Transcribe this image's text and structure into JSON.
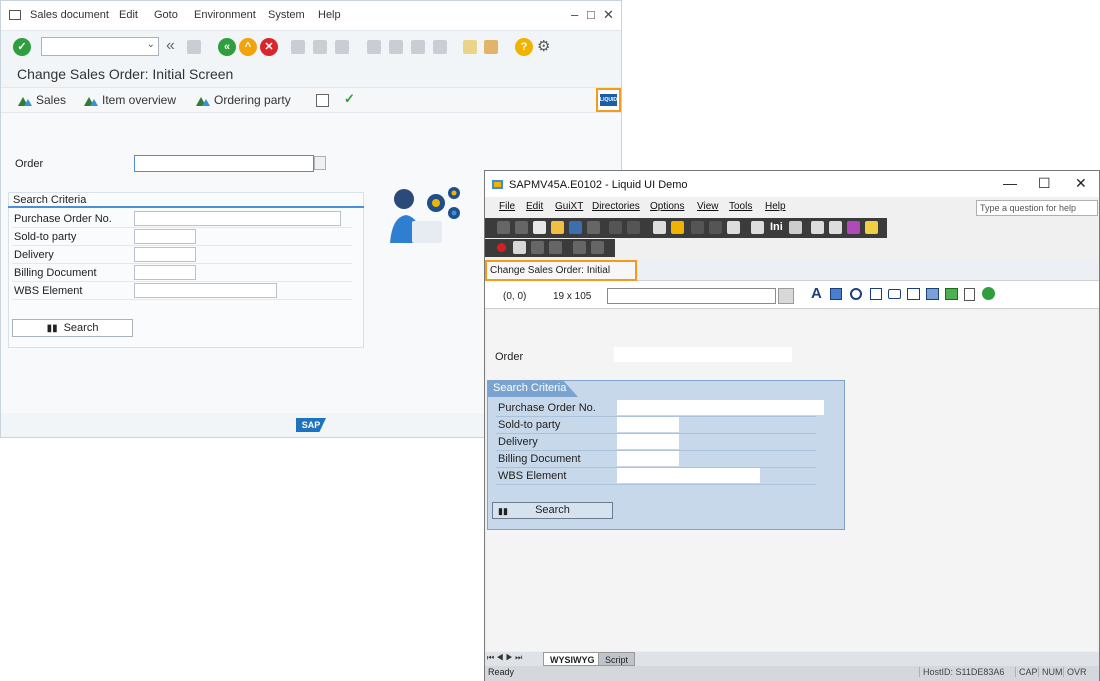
{
  "sap": {
    "menu": [
      "Sales document",
      "Edit",
      "Goto",
      "Environment",
      "System",
      "Help"
    ],
    "screen_title": "Change Sales Order: Initial Screen",
    "app_toolbar": [
      "Sales",
      "Item overview",
      "Ordering party"
    ],
    "order_label": "Order",
    "search_criteria": {
      "title": "Search Criteria",
      "fields": [
        "Purchase Order No.",
        "Sold-to party",
        "Delivery",
        "Billing Document",
        "WBS Element"
      ],
      "button": "Search"
    },
    "logo": "SAP",
    "liquid_button_text": "LIQUID"
  },
  "liquid_ui": {
    "window_title": "SAPMV45A.E0102 - Liquid UI Demo",
    "menu": [
      "File",
      "Edit",
      "GuiXT",
      "Directories",
      "Options",
      "View",
      "Tools",
      "Help"
    ],
    "help_placeholder": "Type a question for help",
    "screen_tab": "Change Sales Order: Initial Screen",
    "coord": "(0, 0)",
    "size": "19 x 105",
    "order_label": "Order",
    "search_criteria": {
      "title": "Search Criteria",
      "fields": [
        "Purchase Order No.",
        "Sold-to party",
        "Delivery",
        "Billing Document",
        "WBS Element"
      ],
      "button": "Search"
    },
    "bottom_tabs": [
      "WYSIWYG",
      "Script"
    ],
    "status": {
      "ready": "Ready",
      "host": "HostID: S11DE83A6",
      "cap": "CAP",
      "num": "NUM",
      "ovr": "OVR"
    }
  },
  "colors": {
    "accent_orange": "#f29b1d",
    "sap_blue": "#1e73be",
    "group_blue": "#c6d8ea"
  }
}
